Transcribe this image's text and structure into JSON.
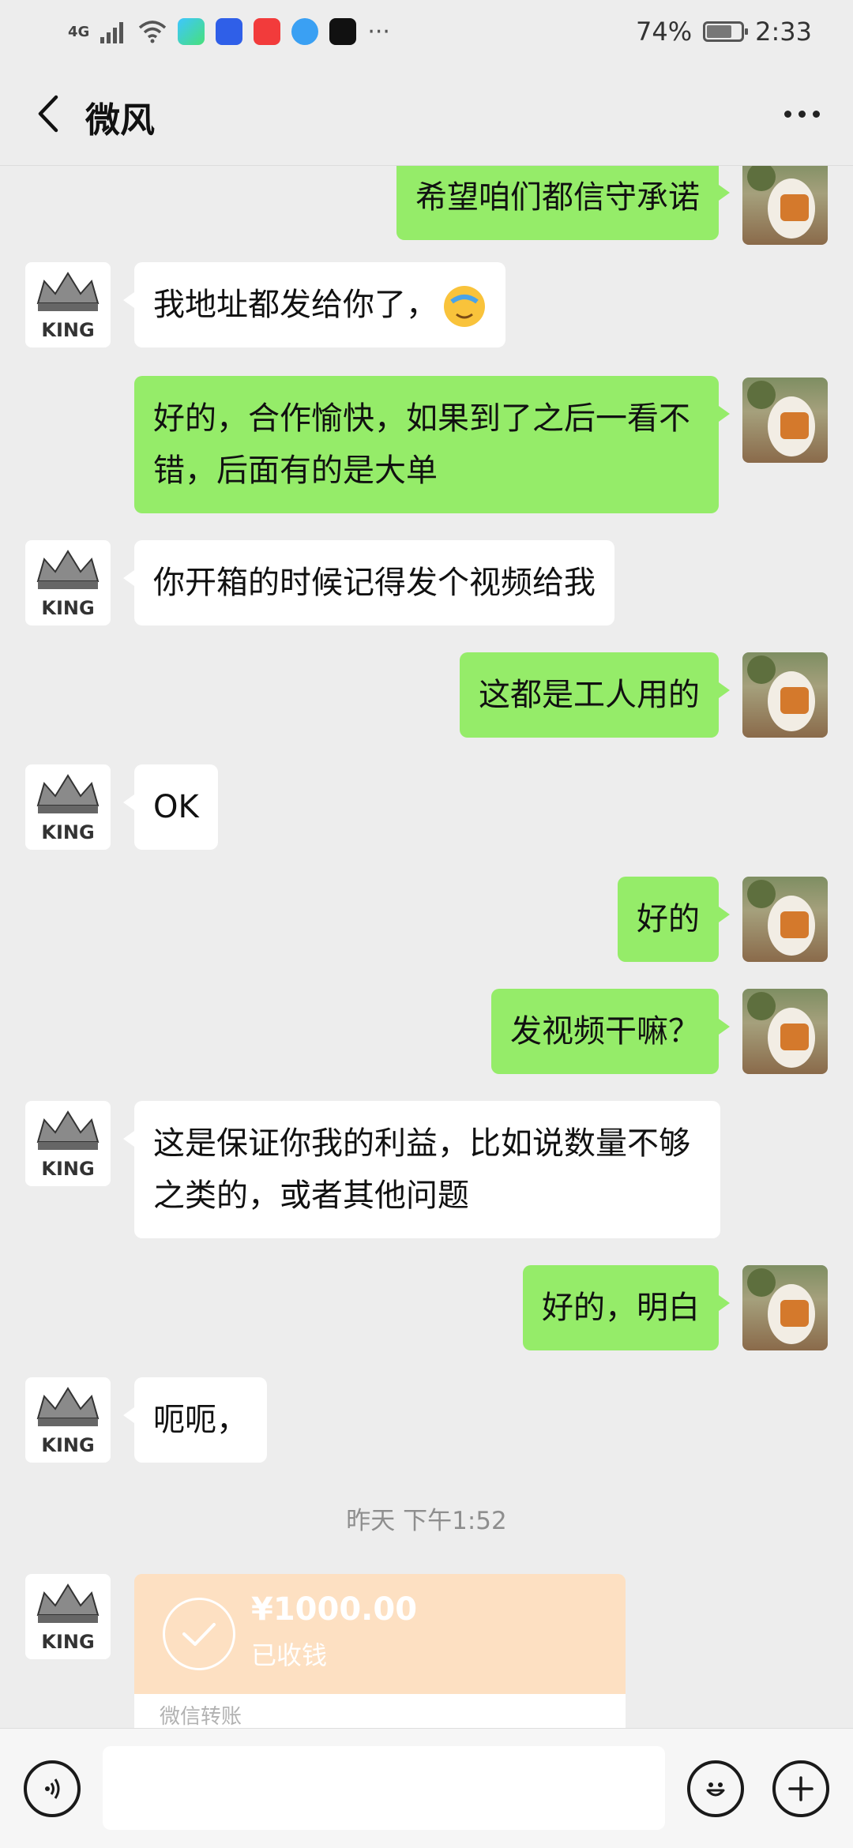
{
  "status_bar": {
    "network": "4G",
    "battery": "74%",
    "battery_level": 0.74,
    "time": "2:33",
    "more": "···"
  },
  "header": {
    "title": "微风",
    "back_icon": "chevron-left-icon",
    "more_icon": "more-horizontal-icon"
  },
  "messages": [
    {
      "side": "out",
      "text": "希望咱们都信守承诺"
    },
    {
      "side": "in",
      "text": "我地址都发给你了，",
      "emoji": "facepalm-crying-emoji"
    },
    {
      "side": "out",
      "text": "好的，合作愉快，如果到了之后一看不错，后面有的是大单"
    },
    {
      "side": "in",
      "text": "你开箱的时候记得发个视频给我"
    },
    {
      "side": "out",
      "text": "这都是工人用的"
    },
    {
      "side": "in",
      "text": "OK"
    },
    {
      "side": "out",
      "text": "好的"
    },
    {
      "side": "out",
      "text": "发视频干嘛？"
    },
    {
      "side": "in",
      "text": "这是保证你我的利益，比如说数量不够之类的，或者其他问题"
    },
    {
      "side": "out",
      "text": "好的，明白"
    },
    {
      "side": "in",
      "text": "呃呃，"
    }
  ],
  "avatars": {
    "contact_text": "KING",
    "contact_icon": "crown-icon",
    "self_icon": "elephant-photo"
  },
  "timestamp": "昨天 下午1:52",
  "transfer": {
    "amount": "¥1000.00",
    "status": "已收钱",
    "label": "微信转账",
    "icon": "check-circle-icon",
    "bg_color": "#fde0c2"
  },
  "input_bar": {
    "voice_icon": "voice-icon",
    "emoji_icon": "smiley-icon",
    "plus_icon": "plus-icon",
    "value": ""
  },
  "colors": {
    "outgoing_bubble": "#95ec69",
    "incoming_bubble": "#ffffff",
    "background": "#ededed"
  }
}
